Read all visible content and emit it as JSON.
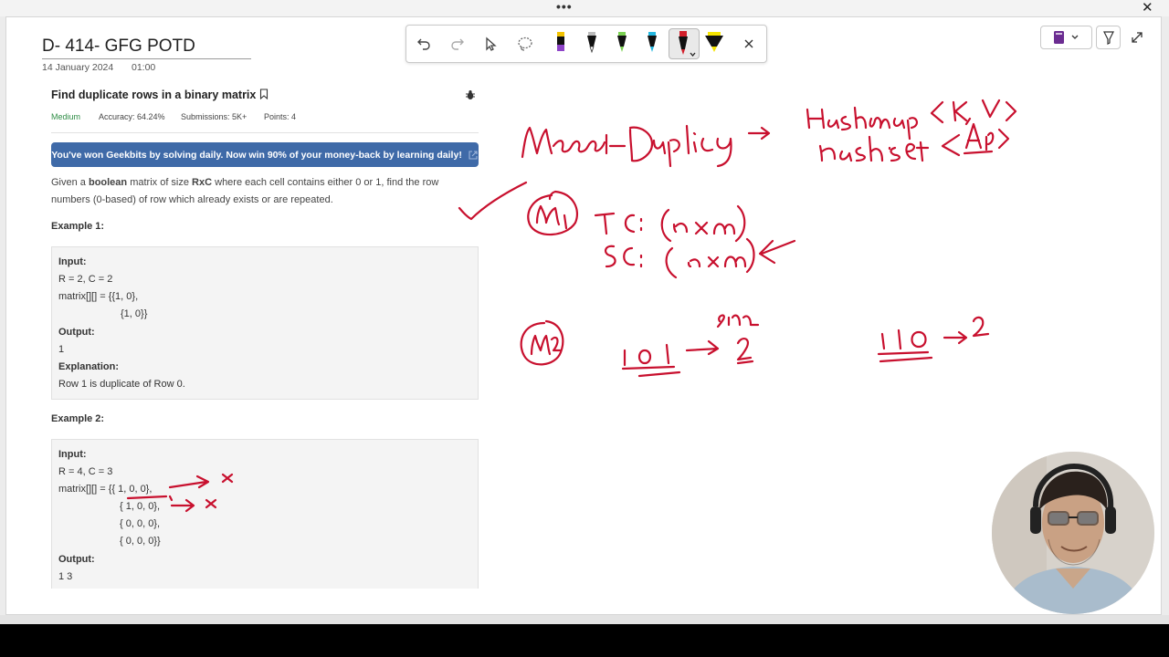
{
  "window": {
    "more_label": "•••",
    "close_label": "✕"
  },
  "note": {
    "title": "D- 414- GFG POTD",
    "date": "14 January 2024",
    "time": "01:00"
  },
  "problem": {
    "title": "Find duplicate rows in a binary matrix",
    "difficulty": "Medium",
    "accuracy": "Accuracy: 64.24%",
    "submissions": "Submissions: 5K+",
    "points": "Points: 4",
    "banner": "You've won Geekbits by solving daily. Now win 90% of your money-back by learning daily!",
    "desc_1a": "Given a ",
    "desc_1b": "boolean",
    "desc_1c": " matrix of size ",
    "desc_1d": "RxC",
    "desc_1e": " where each cell contains either 0 or 1, find the row",
    "desc_2": "numbers (0-based) of row which already exists or are repeated.",
    "example1": {
      "heading": "Example 1:",
      "input_label": "Input:",
      "line1": "R = 2, C = 2",
      "line2": "matrix[][] = {{1, 0},",
      "line3": "              {1, 0}}",
      "output_label": "Output:",
      "output": "1",
      "explanation_label": "Explanation:",
      "explanation": "Row 1 is duplicate of Row 0."
    },
    "example2": {
      "heading": "Example 2:",
      "input_label": "Input:",
      "line1": "R = 4, C = 3",
      "line2": "matrix[][] = {{ 1, 0, 0},",
      "line3": "              { 1, 0, 0},",
      "line4": "              { 0, 0, 0},",
      "line5": "              { 0, 0, 0}}",
      "output_label": "Output:",
      "output": "1 3"
    }
  },
  "colors": {
    "ink": "#c8102e",
    "banner": "#3f6aa8",
    "medium": "#2f8d46"
  }
}
